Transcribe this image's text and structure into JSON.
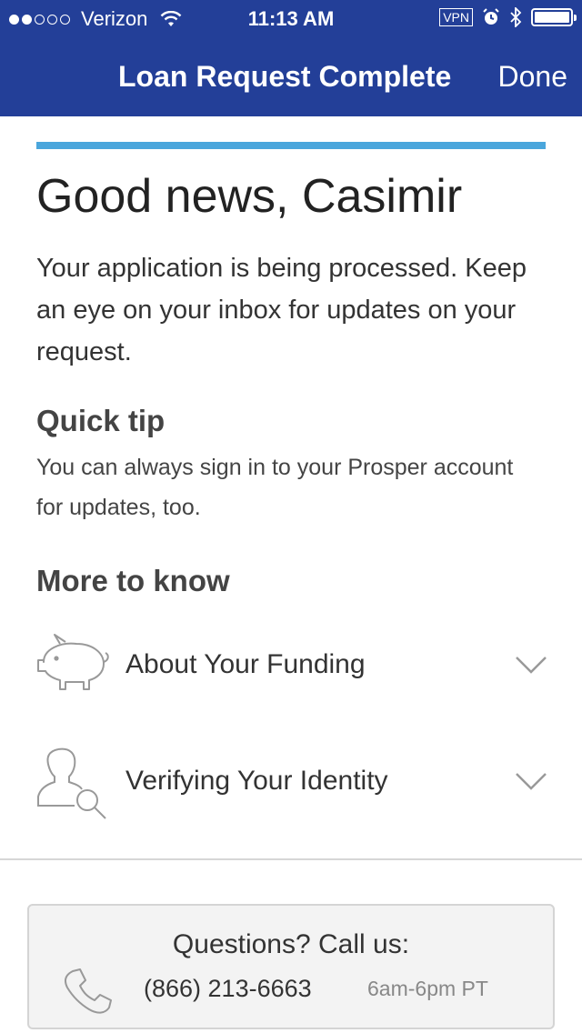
{
  "status_bar": {
    "carrier": "Verizon",
    "time": "11:13 AM",
    "vpn": "VPN"
  },
  "nav": {
    "title": "Loan Request Complete",
    "done_label": "Done"
  },
  "content": {
    "headline": "Good news, Casimir",
    "lead": "Your application is being processed. Keep an eye on your inbox for updates on your request.",
    "tip_heading": "Quick tip",
    "tip_text": "You can always sign in to your Prosper account for updates, too.",
    "more_heading": "More to know"
  },
  "accordion": [
    {
      "label": "About Your Funding",
      "icon": "piggy-bank-icon"
    },
    {
      "label": "Verifying Your Identity",
      "icon": "user-search-icon"
    }
  ],
  "contact": {
    "question": "Questions? Call us:",
    "phone": "(866) 213-6663",
    "hours": "6am-6pm PT"
  },
  "colors": {
    "nav_bg": "#233f98",
    "accent": "#4aa6dc"
  }
}
